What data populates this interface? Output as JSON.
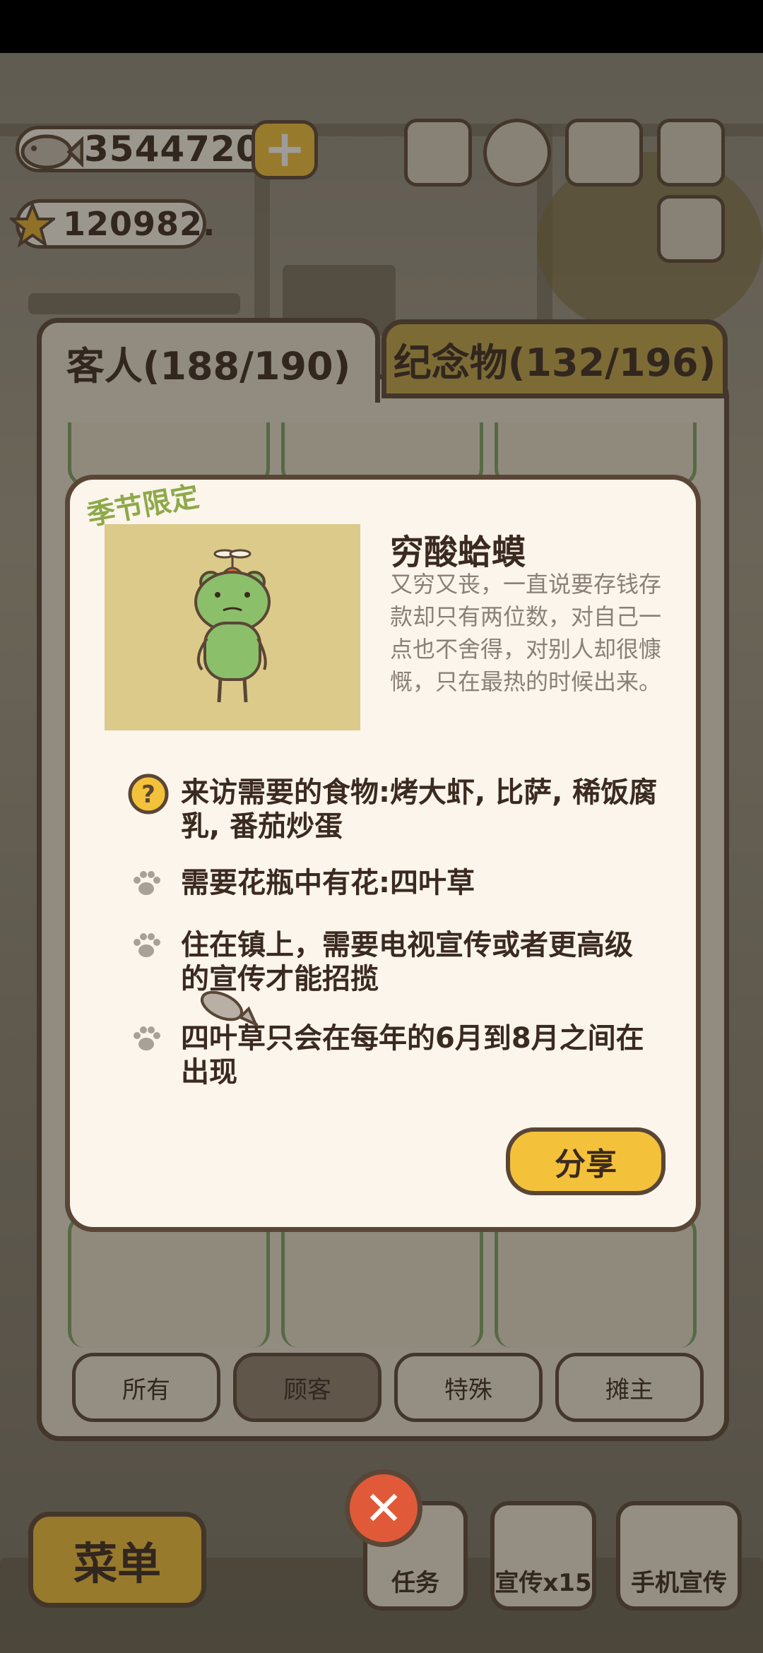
{
  "currency": {
    "coins": "3544720",
    "stars": "120982.",
    "plus_label": "+"
  },
  "tabs": {
    "guests": "客人(188/190)",
    "souvenirs": "纪念物(132/196)"
  },
  "filters": [
    "所有",
    "顾客",
    "特殊",
    "摊主"
  ],
  "active_filter": "顾客",
  "dialog": {
    "season_tag": "季节限定",
    "name": "穷酸蛤蟆",
    "description": "又穷又丧，一直说要存钱存款却只有两位数，对自己一点也不舍得，对别人却很慷慨，只在最热的时候出来。",
    "requirements": [
      {
        "icon": "question-icon",
        "text": "来访需要的食物:烤大虾, 比萨, 稀饭腐乳, 番茄炒蛋"
      },
      {
        "icon": "paw-icon",
        "text": "需要花瓶中有花:四叶草"
      },
      {
        "icon": "paw-icon",
        "text": "住在镇上，需要电视宣传或者更高级的宣传才能招揽"
      },
      {
        "icon": "paw-icon",
        "text": "四叶草只会在每年的6月到8月之间在出现"
      }
    ],
    "share_label": "分享",
    "close_label": "✕"
  },
  "bottom": {
    "menu": "菜单",
    "tasks": "任务",
    "promo": "宣传x15",
    "phone_promo": "手机宣传"
  },
  "colors": {
    "accent": "#f4c23a",
    "border": "#5a4636",
    "panel": "#e9e2d2",
    "dialog": "#fbf5ec",
    "season": "#8ea94a"
  }
}
